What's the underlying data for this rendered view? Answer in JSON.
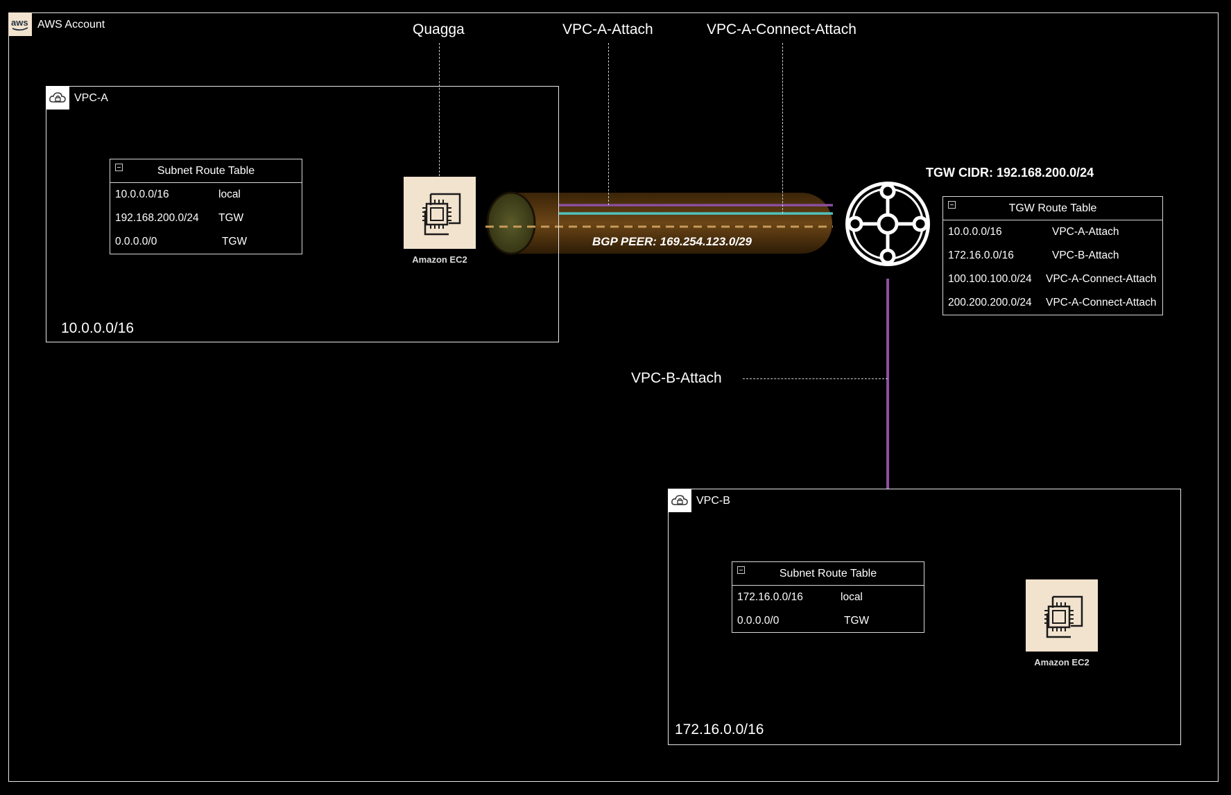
{
  "account": {
    "label": "AWS Account",
    "icon": "aws-logo-icon"
  },
  "top_labels": {
    "quagga": "Quagga",
    "vpc_a_attach": "VPC-A-Attach",
    "vpc_a_connect_attach": "VPC-A-Connect-Attach"
  },
  "vpc_a": {
    "name": "VPC-A",
    "cidr": "10.0.0.0/16",
    "icon": "vpc-cloud-lock-icon",
    "route_table": {
      "title": "Subnet Route Table",
      "rows": [
        {
          "dest": "10.0.0.0/16",
          "target": "local"
        },
        {
          "dest": "192.168.200.0/24",
          "target": "TGW"
        },
        {
          "dest": "0.0.0.0/0",
          "target": "TGW"
        }
      ]
    },
    "ec2": {
      "label": "Amazon EC2",
      "icon": "ec2-chip-icon"
    }
  },
  "tunnel": {
    "label": "BGP PEER: 169.254.123.0/29"
  },
  "tgw": {
    "cidr_label": "TGW CIDR: 192.168.200.0/24",
    "icon": "transit-gateway-icon",
    "route_table": {
      "title": "TGW Route Table",
      "rows": [
        {
          "dest": "10.0.0.0/16",
          "target": "VPC-A-Attach"
        },
        {
          "dest": "172.16.0.0/16",
          "target": "VPC-B-Attach"
        },
        {
          "dest": "100.100.100.0/24",
          "target": "VPC-A-Connect-Attach"
        },
        {
          "dest": "200.200.200.0/24",
          "target": "VPC-A-Connect-Attach"
        }
      ]
    }
  },
  "vpc_b_attach": {
    "label": "VPC-B-Attach"
  },
  "vpc_b": {
    "name": "VPC-B",
    "cidr": "172.16.0.0/16",
    "icon": "vpc-cloud-lock-icon",
    "route_table": {
      "title": "Subnet Route Table",
      "rows": [
        {
          "dest": "172.16.0.0/16",
          "target": "local"
        },
        {
          "dest": "0.0.0.0/0",
          "target": "TGW"
        }
      ]
    },
    "ec2": {
      "label": "Amazon EC2",
      "icon": "ec2-chip-icon"
    }
  },
  "colors": {
    "purple": "#8b4fa0",
    "teal": "#4fc3c0",
    "tunnel": "#5a3a12",
    "tunnel_dash": "#c89a5a",
    "ec2_bg": "#f2e3cf"
  }
}
